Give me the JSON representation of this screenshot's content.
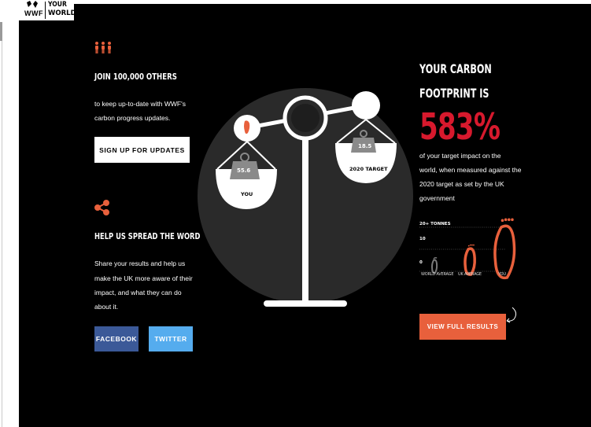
{
  "logo": {
    "brand": "WWF",
    "line1": "YOUR",
    "line2": "WORLD"
  },
  "join": {
    "heading": "JOIN 100,000 OTHERS",
    "text_line1": "to keep up-to-date with WWF's",
    "text_line2": "carbon progress updates.",
    "button": "SIGN UP FOR UPDATES"
  },
  "share": {
    "heading": "HELP US SPREAD THE WORD",
    "text_line1": "Share your results and help us",
    "text_line2": "make the UK more aware of their",
    "text_line3": "impact, and what they can do",
    "text_line4": "about it.",
    "facebook": "FACEBOOK",
    "twitter": "TWITTER"
  },
  "scale": {
    "you_value": "55.6",
    "you_label": "YOU",
    "target_value": "18.5",
    "target_label": "2020 TARGET"
  },
  "result": {
    "heading_line1": "YOUR CARBON",
    "heading_line2": "FOOTPRINT IS",
    "percent": "583%",
    "desc_line1": "of your target impact on the",
    "desc_line2": "world, when measured against the",
    "desc_line3": "2020 target as set by the UK",
    "desc_line4": "government",
    "button": "VIEW FULL RESULTS"
  },
  "footprint_chart": {
    "ytick_top": "20+ TONNES",
    "ytick_mid": "10",
    "ytick_zero": "0",
    "bars": [
      {
        "label": "WORLD AVERAGE",
        "value": 5
      },
      {
        "label": "UK AVERAGE",
        "value": 10
      },
      {
        "label": "YOU",
        "value": 20
      }
    ]
  },
  "colors": {
    "accent_orange": "#e8603c",
    "percent_red": "#d7192d",
    "facebook": "#3b5998",
    "twitter": "#55acee"
  }
}
